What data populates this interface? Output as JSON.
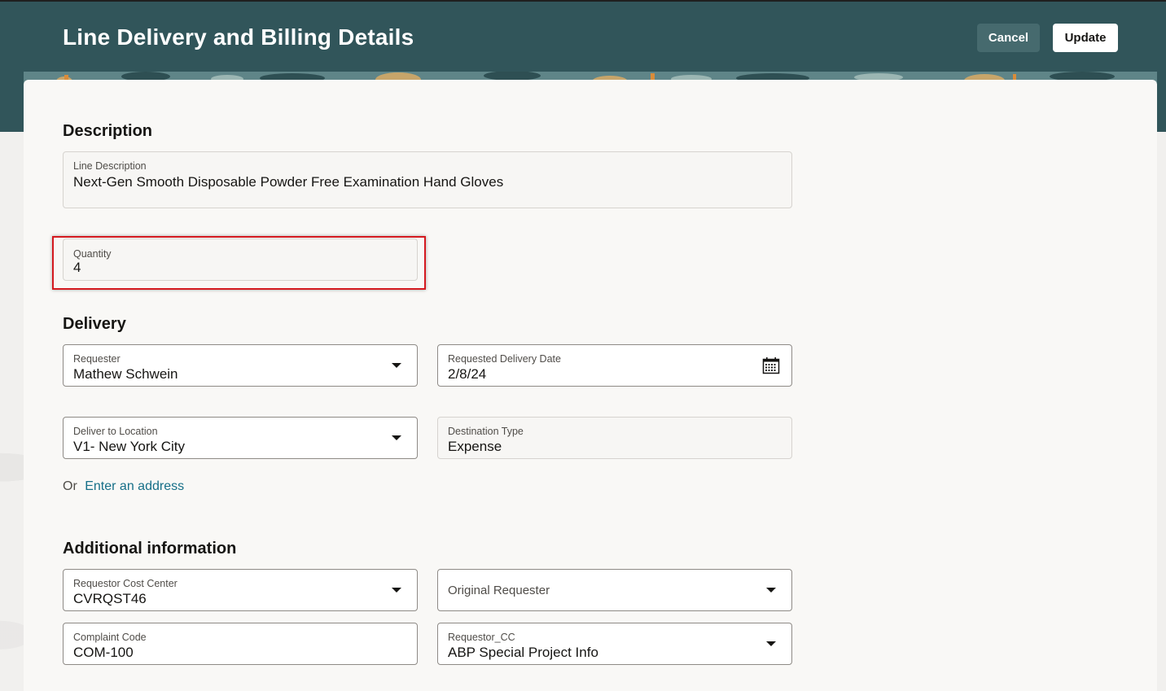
{
  "header": {
    "title": "Line Delivery and Billing Details",
    "cancel_label": "Cancel",
    "update_label": "Update"
  },
  "description_section": {
    "title": "Description",
    "line_description": {
      "label": "Line Description",
      "value": "Next-Gen Smooth Disposable Powder Free Examination Hand Gloves"
    },
    "quantity": {
      "label": "Quantity",
      "value": "4"
    }
  },
  "delivery_section": {
    "title": "Delivery",
    "requester": {
      "label": "Requester",
      "value": "Mathew Schwein",
      "icon": "chevron-down-icon"
    },
    "requested_delivery_date": {
      "label": "Requested Delivery Date",
      "value": "2/8/24",
      "icon": "calendar-icon"
    },
    "deliver_to_location": {
      "label": "Deliver to Location",
      "value": "V1- New York City",
      "icon": "chevron-down-icon"
    },
    "destination_type": {
      "label": "Destination Type",
      "value": "Expense"
    },
    "or_text": "Or",
    "address_link": "Enter an address"
  },
  "additional_section": {
    "title": "Additional information",
    "requestor_cost_center": {
      "label": "Requestor Cost Center",
      "value": "CVRQST46"
    },
    "original_requester": {
      "placeholder": "Original Requester"
    },
    "complaint_code": {
      "label": "Complaint Code",
      "value": "COM-100"
    },
    "requestor_cc": {
      "label": "Requestor_CC",
      "value": "ABP Special Project Info"
    }
  },
  "colors": {
    "header_bg": "#31555a",
    "highlight": "#d4191f",
    "link": "#166f88"
  }
}
